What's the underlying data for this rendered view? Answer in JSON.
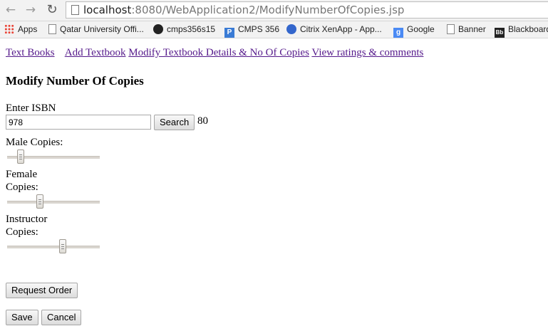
{
  "browser": {
    "url_host": "localhost",
    "url_path": ":8080/WebApplication2/ModifyNumberOfCopies.jsp",
    "bookmarks": [
      {
        "label": "Apps",
        "icon": "apps-icon"
      },
      {
        "label": "Qatar University Offi...",
        "icon": "page-icon"
      },
      {
        "label": "cmps356s15",
        "icon": "github-icon"
      },
      {
        "label": "CMPS 356",
        "icon": "p-icon"
      },
      {
        "label": "Citrix XenApp - App...",
        "icon": "citrix-icon"
      },
      {
        "label": "Google",
        "icon": "google-icon"
      },
      {
        "label": "Banner",
        "icon": "page-icon"
      },
      {
        "label": "Blackboard",
        "icon": "blackboard-icon"
      }
    ]
  },
  "nav_links": [
    "Text Books",
    "Add Textbook",
    "Modify Textbook Details & No Of Copies",
    "View ratings & comments"
  ],
  "page_title": "Modify Number Of Copies",
  "isbn": {
    "label": "Enter ISBN",
    "value": "978",
    "search_label": "Search",
    "result": "80"
  },
  "sliders": [
    {
      "label": "Male Copies:",
      "level": 0.12
    },
    {
      "label": "Female Copies:",
      "level": 0.34
    },
    {
      "label": "Instructor Copies:",
      "level": 0.61
    }
  ],
  "buttons": {
    "request_order": "Request Order",
    "save": "Save",
    "cancel": "Cancel"
  },
  "colors": {
    "link_visited": "#551a8b",
    "toolbar": "#f2f2f2"
  }
}
